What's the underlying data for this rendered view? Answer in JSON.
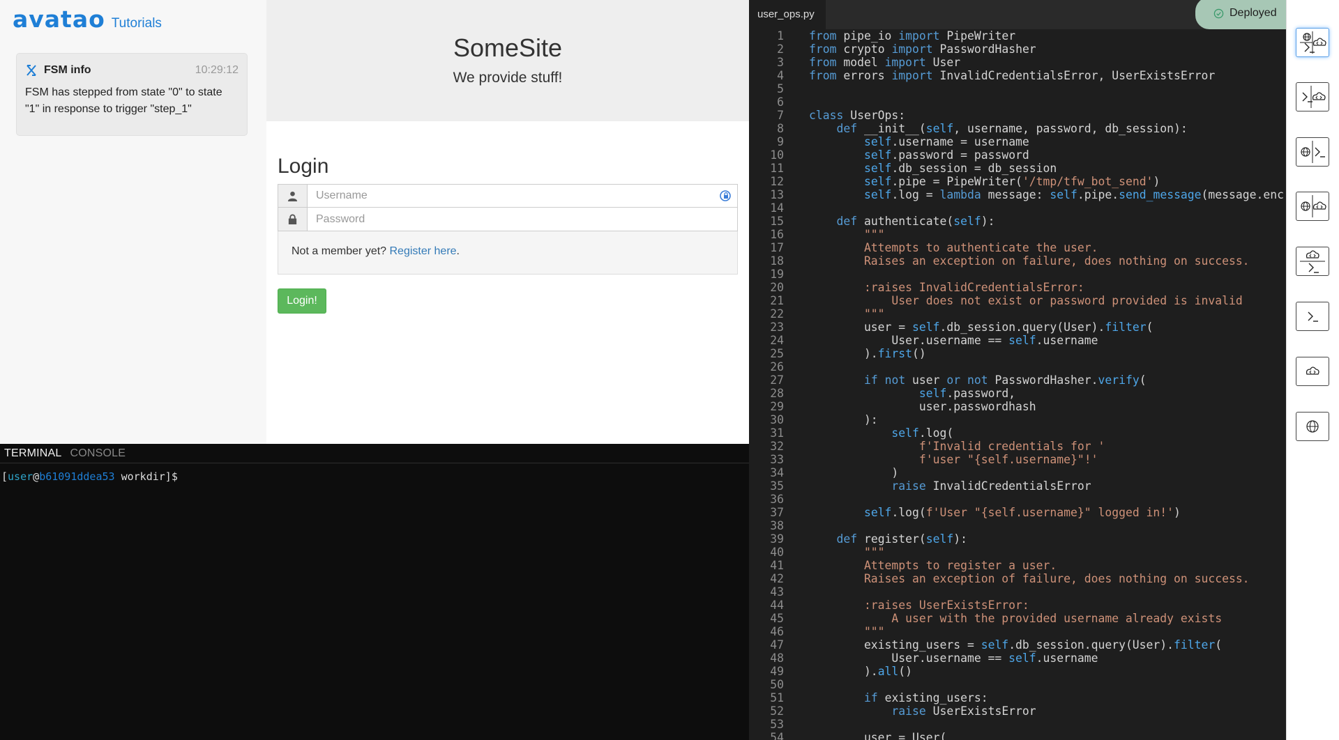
{
  "brand": {
    "logo": "avatao",
    "sub": "Tutorials"
  },
  "fsm": {
    "title": "FSM info",
    "time": "10:29:12",
    "message": "FSM has stepped from state \"0\" to state \"1\" in response to trigger \"step_1\""
  },
  "site": {
    "title": "SomeSite",
    "tagline": "We provide stuff!",
    "login_title": "Login",
    "username_placeholder": "Username",
    "password_placeholder": "Password",
    "not_member": "Not a member yet? ",
    "register_link": "Register here",
    "register_period": ".",
    "login_button": "Login!"
  },
  "terminal": {
    "tabs": [
      "TERMINAL",
      "CONSOLE"
    ],
    "prompt_open": "[",
    "user": "user",
    "at": "@",
    "host": "b61091ddea53",
    "rest": " workdir]$"
  },
  "editor": {
    "filename": "user_ops.py",
    "deploy_status": "Deployed",
    "lines": [
      "from pipe_io import PipeWriter",
      "from crypto import PasswordHasher",
      "from model import User",
      "from errors import InvalidCredentialsError, UserExistsError",
      "",
      "",
      "class UserOps:",
      "    def __init__(self, username, password, db_session):",
      "        self.username = username",
      "        self.password = password",
      "        self.db_session = db_session",
      "        self.pipe = PipeWriter('/tmp/tfw_bot_send')",
      "        self.log = lambda message: self.pipe.send_message(message.enc",
      "",
      "    def authenticate(self):",
      "        \"\"\"",
      "        Attempts to authenticate the user.",
      "        Raises an exception on failure, does nothing on success.",
      "",
      "        :raises InvalidCredentialsError:",
      "            User does not exist or password provided is invalid",
      "        \"\"\"",
      "        user = self.db_session.query(User).filter(",
      "            User.username == self.username",
      "        ).first()",
      "",
      "        if not user or not PasswordHasher.verify(",
      "                self.password,",
      "                user.passwordhash",
      "        ):",
      "            self.log(",
      "                f'Invalid credentials for '",
      "                f'user \"{self.username}\"!'",
      "            )",
      "            raise InvalidCredentialsError",
      "",
      "        self.log(f'User \"{self.username}\" logged in!')",
      "",
      "    def register(self):",
      "        \"\"\"",
      "        Attempts to register a user.",
      "        Raises an exception of failure, does nothing on success.",
      "",
      "        :raises UserExistsError:",
      "            A user with the provided username already exists",
      "        \"\"\"",
      "        existing_users = self.db_session.query(User).filter(",
      "            User.username == self.username",
      "        ).all()",
      "",
      "        if existing_users:",
      "            raise UserExistsError",
      "",
      "        user = User("
    ]
  },
  "rail": {
    "buttons": [
      {
        "icon": "web-terminal-ide-layout-icon"
      },
      {
        "icon": "terminal-ide-layout-icon"
      },
      {
        "icon": "web-terminal-layout-icon"
      },
      {
        "icon": "web-ide-layout-icon"
      },
      {
        "icon": "ide-terminal-layout-icon"
      },
      {
        "icon": "terminal-only-icon"
      },
      {
        "icon": "ide-only-icon"
      },
      {
        "icon": "web-only-icon"
      }
    ]
  },
  "colors": {
    "brand": "#1f7fd6",
    "login_button": "#5cb85c",
    "link": "#337ab7",
    "editor_bg": "#1e1e1e",
    "deploy_badge": "#a7c7b5",
    "keyword": "#569cd6",
    "string": "#ce9178"
  }
}
